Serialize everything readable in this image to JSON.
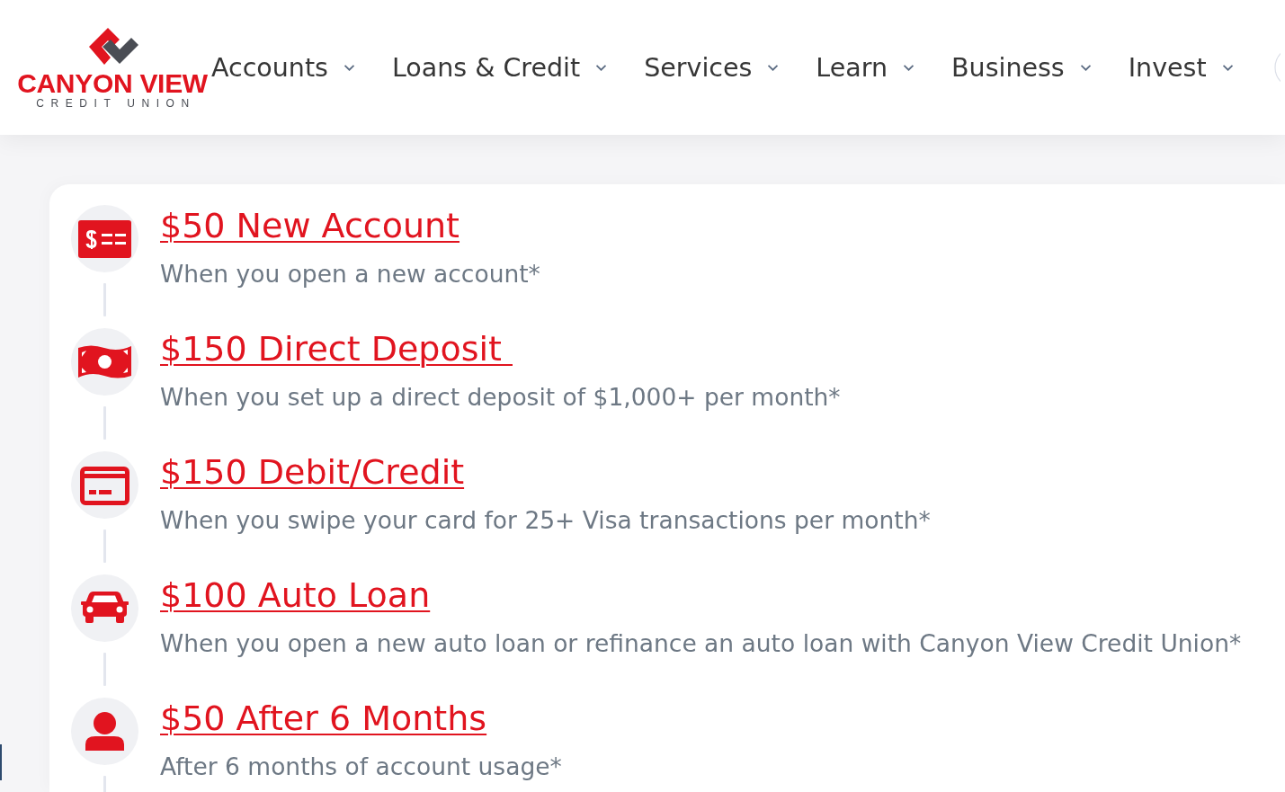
{
  "header": {
    "logo": {
      "name": "CANYON VIEW",
      "tagline": "CREDIT UNION"
    },
    "nav": [
      "Accounts",
      "Loans & Credit",
      "Services",
      "Learn",
      "Business",
      "Invest"
    ]
  },
  "rewards": [
    {
      "kind": "check",
      "title": "$50 New Account",
      "description": "When you open a new account*"
    },
    {
      "kind": "cash",
      "title": "$150 Direct Deposit ",
      "description": "When you set up a direct deposit of $1,000+ per month*"
    },
    {
      "kind": "card",
      "title": "$150 Debit/Credit",
      "description": "When you swipe your card for 25+ Visa transactions per month*"
    },
    {
      "kind": "car",
      "title": "$100 Auto Loan",
      "description": "When you open a new auto loan or refinance an auto loan with Canyon View Credit Union*"
    },
    {
      "kind": "person",
      "title": "$50 After 6 Months",
      "description": "After 6 months of account usage*"
    }
  ]
}
